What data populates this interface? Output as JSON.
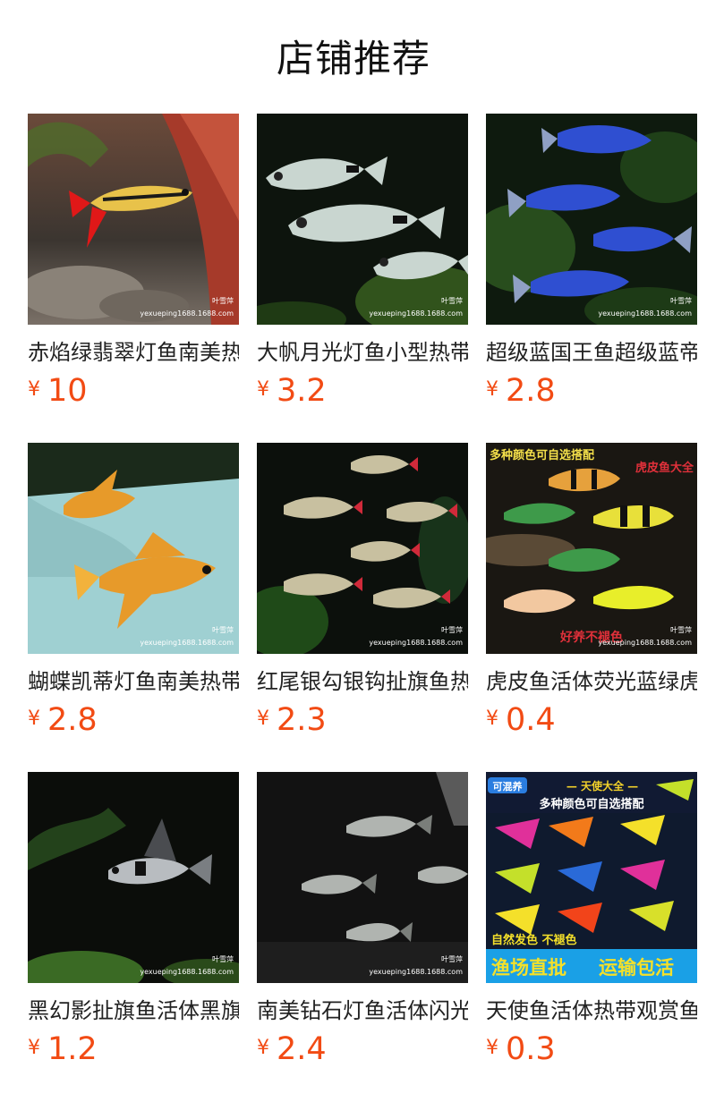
{
  "header": {
    "title": "店铺推荐"
  },
  "currency": "¥",
  "watermark": {
    "name": "叶雪萍",
    "site": "yexueping1688.1688.com"
  },
  "products": [
    {
      "name": "赤焰绿翡翠灯鱼南美热带鱼",
      "price": "10",
      "image_icon": "red-fin-tetra-photo",
      "overlay": []
    },
    {
      "name": "大帆月光灯鱼小型热带鱼",
      "price": "3.2",
      "image_icon": "silver-tetra-school-photo",
      "overlay": []
    },
    {
      "name": "超级蓝国王鱼超级蓝帝",
      "price": "2.8",
      "image_icon": "blue-emperor-tetra-photo",
      "overlay": []
    },
    {
      "name": "蝴蝶凯蒂灯鱼南美热带鱼",
      "price": "2.8",
      "image_icon": "golden-butterfly-tetra-photo",
      "overlay": []
    },
    {
      "name": "红尾银勾银钩扯旗鱼热带",
      "price": "2.3",
      "image_icon": "red-tail-flag-tetra-photo",
      "overlay": []
    },
    {
      "name": "虎皮鱼活体荧光蓝绿虎皮",
      "price": "0.4",
      "image_icon": "tiger-barb-collage-photo",
      "overlay": [
        "多种颜色可自选搭配",
        "虎皮鱼大全",
        "好养不褪色"
      ]
    },
    {
      "name": "黑幻影扯旗鱼活体黑旗",
      "price": "1.2",
      "image_icon": "black-phantom-tetra-photo",
      "overlay": []
    },
    {
      "name": "南美钻石灯鱼活体闪光",
      "price": "2.4",
      "image_icon": "diamond-tetra-photo",
      "overlay": []
    },
    {
      "name": "天使鱼活体热带观赏鱼",
      "price": "0.3",
      "image_icon": "glofish-angel-collage-photo",
      "overlay": [
        "可混养",
        "— 天使大全 —",
        "多种颜色可自选搭配",
        "自然发色 不褪色",
        "渔场直批",
        "运输包活"
      ]
    }
  ]
}
